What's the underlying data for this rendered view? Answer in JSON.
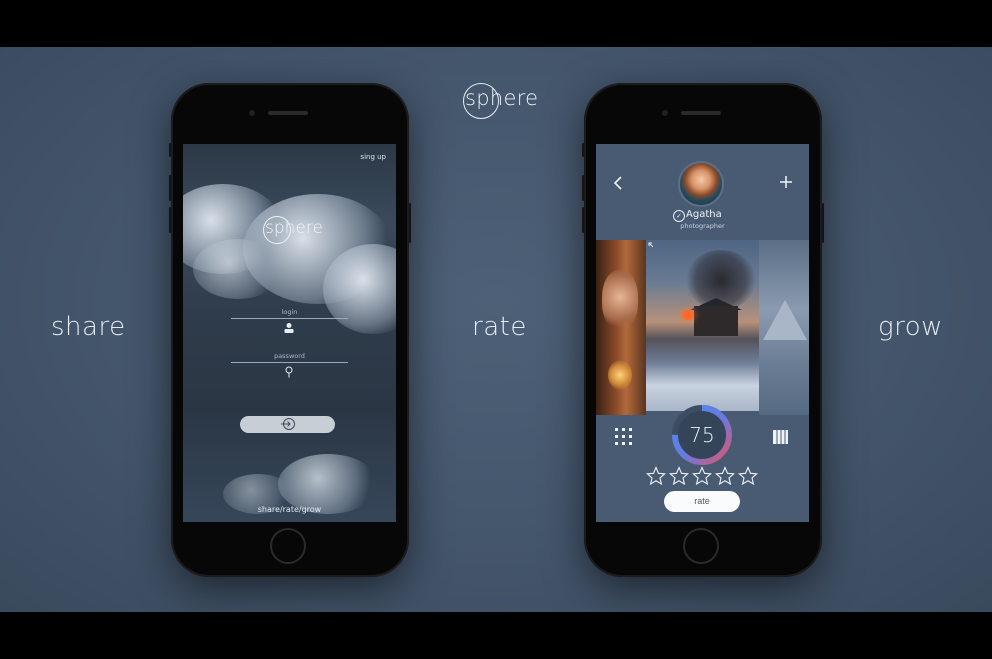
{
  "brand": {
    "name": "sphere"
  },
  "taglines": {
    "left": "share",
    "center": "rate",
    "right": "grow"
  },
  "login_screen": {
    "signup_link": "sing up",
    "logo": "sphere",
    "login_label": "login",
    "password_label": "password",
    "login_button_icon": "enter-icon",
    "footer": "share/rate/grow"
  },
  "rate_screen": {
    "user": {
      "name": "Agatha",
      "role": "photographer"
    },
    "score": "75",
    "score_fraction": 0.75,
    "stars_total": 5,
    "stars_filled": 0,
    "rate_button": "rate",
    "icons": [
      "back-icon",
      "plus-icon",
      "verified-icon",
      "expand-icon",
      "grid-icon",
      "gallery-icon"
    ]
  },
  "colors": {
    "background": "#44566c",
    "frame": "#000000",
    "score_ring_blue": "#4a8cf0",
    "score_ring_red": "#e0566a"
  }
}
